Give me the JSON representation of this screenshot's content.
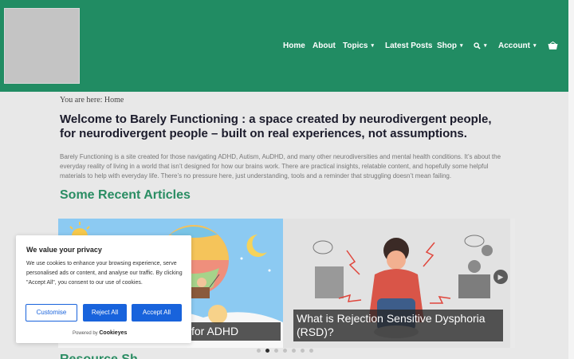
{
  "header": {
    "nav": [
      {
        "label": "Home",
        "dropdown": false
      },
      {
        "label": "About",
        "dropdown": false
      },
      {
        "label": "Topics",
        "dropdown": true
      },
      {
        "label": "Latest Posts",
        "dropdown": false
      },
      {
        "label": "Shop",
        "dropdown": true
      },
      {
        "label": "Account",
        "dropdown": true
      }
    ],
    "search_icon": "search-icon",
    "cart_icon": "basket-icon",
    "caret": "▾"
  },
  "breadcrumb": "You are here: Home",
  "hero": {
    "title": "Welcome to Barely Functioning : a space created by neurodivergent people, for neurodivergent people – built on real experiences, not assumptions.",
    "intro": "Barely Functioning is a site created for those navigating ADHD, Autism, AuDHD, and many other neurodiversities and mental health conditions. It’s about the everyday reality of living in a world that isn’t designed for how our brains work. There are practical insights, relatable content, and hopefully some helpful materials to help with everyday life. There’s no pressure here, just understanding, tools and a reminder that struggling doesn’t mean failing."
  },
  "recent": {
    "heading": "Some Recent Articles",
    "slides": [
      {
        "caption": "for ADHD"
      },
      {
        "caption": "What is Rejection Sensitive Dysphoria (RSD)?"
      }
    ],
    "dots_count": 7,
    "active_dot": 1
  },
  "next_heading": "Resource Sh",
  "cookie": {
    "title": "We value your privacy",
    "text": "We use cookies to enhance your browsing experience, serve personalised ads or content, and analyse our traffic. By clicking \"Accept All\", you consent to our use of cookies.",
    "customise": "Customise",
    "reject": "Reject All",
    "accept": "Accept All",
    "powered_by": "Powered by",
    "brand": "Cookieyes"
  },
  "colors": {
    "header": "#218c63",
    "accent": "#2a8d63",
    "cookie_button": "#1863dc"
  }
}
